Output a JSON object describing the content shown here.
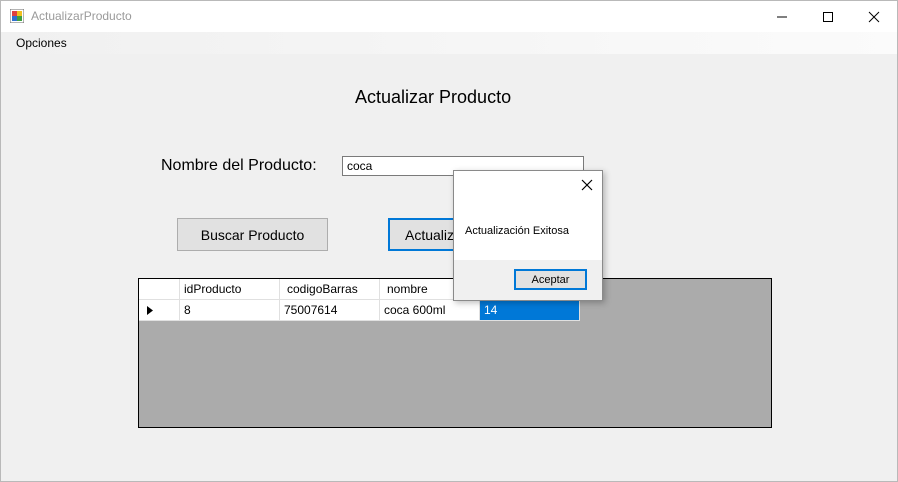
{
  "window": {
    "title": "ActualizarProducto"
  },
  "menu": {
    "items": [
      "Opciones"
    ]
  },
  "form": {
    "title": "Actualizar Producto",
    "name_label": "Nombre del Producto:",
    "name_value": "coca",
    "search_button": "Buscar Producto",
    "update_button": "Actualiz"
  },
  "grid": {
    "columns": [
      "idProducto",
      "codigoBarras",
      "nombre"
    ],
    "rows": [
      {
        "cells": [
          "8",
          "75007614",
          "coca 600ml",
          "14"
        ],
        "selected_cell": 3
      }
    ]
  },
  "dialog": {
    "message": "Actualización Exitosa",
    "ok_button": "Aceptar"
  },
  "colors": {
    "accent": "#0078d7",
    "grid_background": "#ababab",
    "window_background": "#f0f0f0"
  },
  "icons": {
    "app": "app-icon",
    "minimize": "minimize-icon",
    "maximize": "maximize-icon",
    "close": "close-icon",
    "row_indicator": "row-pointer-icon"
  }
}
